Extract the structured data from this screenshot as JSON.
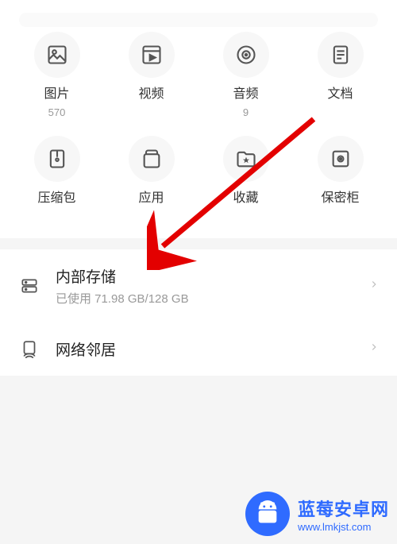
{
  "categories": [
    {
      "label": "图片",
      "count": "570",
      "icon": "image"
    },
    {
      "label": "视频",
      "count": "",
      "icon": "video"
    },
    {
      "label": "音频",
      "count": "9",
      "icon": "audio"
    },
    {
      "label": "文档",
      "count": "",
      "icon": "document"
    },
    {
      "label": "压缩包",
      "count": "",
      "icon": "archive"
    },
    {
      "label": "应用",
      "count": "",
      "icon": "app"
    },
    {
      "label": "收藏",
      "count": "",
      "icon": "favorite"
    },
    {
      "label": "保密柜",
      "count": "",
      "icon": "safe"
    }
  ],
  "storage": {
    "title": "内部存储",
    "subtitle": "已使用 71.98 GB/128 GB"
  },
  "network": {
    "title": "网络邻居"
  },
  "watermark": {
    "title": "蓝莓安卓网",
    "url": "www.lmkjst.com"
  }
}
